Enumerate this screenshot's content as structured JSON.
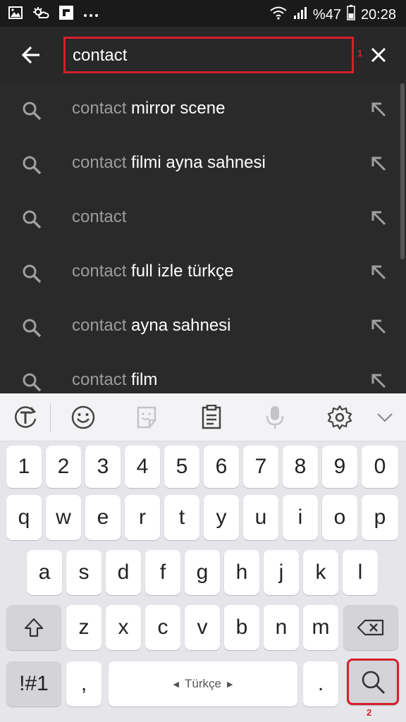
{
  "status_bar": {
    "battery_text": "%47",
    "time": "20:28"
  },
  "search": {
    "value": "contact",
    "marker_1": "1",
    "marker_2": "2"
  },
  "suggestions": [
    {
      "typed": "contact",
      "rest": " mirror scene"
    },
    {
      "typed": "contact",
      "rest": " filmi ayna sahnesi"
    },
    {
      "typed": "contact",
      "rest": ""
    },
    {
      "typed": "contact",
      "rest": " full izle türkçe"
    },
    {
      "typed": "contact",
      "rest": " ayna sahnesi"
    },
    {
      "typed": "contact",
      "rest": " film"
    }
  ],
  "keyboard": {
    "number_row": [
      "1",
      "2",
      "3",
      "4",
      "5",
      "6",
      "7",
      "8",
      "9",
      "0"
    ],
    "row1": [
      "q",
      "w",
      "e",
      "r",
      "t",
      "y",
      "u",
      "i",
      "o",
      "p"
    ],
    "row2": [
      "a",
      "s",
      "d",
      "f",
      "g",
      "h",
      "j",
      "k",
      "l"
    ],
    "row3": [
      "z",
      "x",
      "c",
      "v",
      "b",
      "n",
      "m"
    ],
    "symbols_label": "!#1",
    "comma_label": ",",
    "space_label": "Türkçe",
    "period_label": "."
  },
  "icons": {
    "statusbar": [
      "gallery-icon",
      "weather-icon",
      "flipboard-icon",
      "more-dots-icon",
      "wifi-icon",
      "signal-icon",
      "battery-icon"
    ],
    "toolbar": [
      "translate-icon",
      "emoji-icon",
      "sticker-icon",
      "clipboard-icon",
      "mic-icon",
      "settings-icon",
      "collapse-icon"
    ]
  },
  "colors": {
    "highlight_red": "#d4202a",
    "background_dark": "#2a2a2a",
    "suggestion_typed": "#9c9c9c",
    "keyboard_bg": "#e6e6ea"
  }
}
